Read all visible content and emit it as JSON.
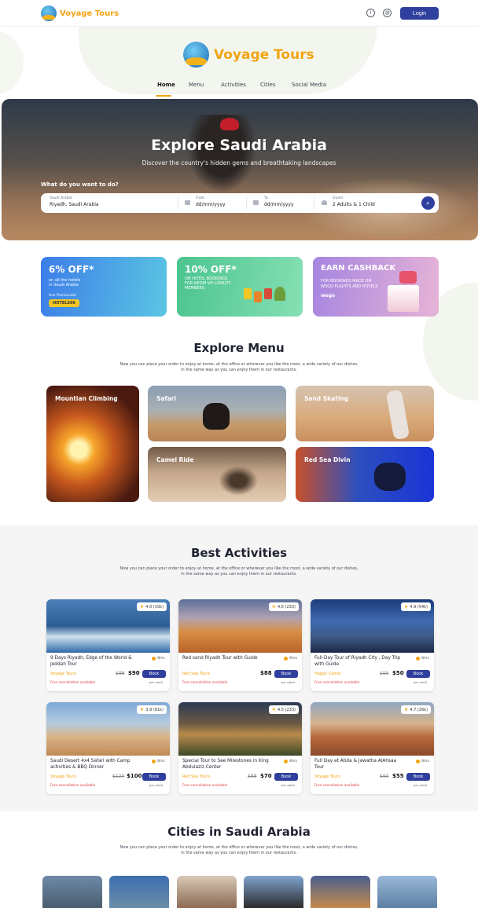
{
  "header": {
    "brand": "Voyage Tours",
    "info_icon": "info-icon",
    "globe_icon": "globe-icon",
    "login_label": "Login"
  },
  "brand_big": "Voyage Tours",
  "nav": {
    "items": [
      "Home",
      "Menu",
      "Activities",
      "Cities",
      "Social Media"
    ],
    "active": "Home"
  },
  "hero": {
    "title": "Explore Saudi Arabia",
    "subtitle": "Discover the country's hidden gems and breathtaking landscapes",
    "question": "What do you want to do?",
    "search": {
      "location_label": "Saudi Arabia",
      "location_value": "Riyadh, Saudi Arabia",
      "from_label": "From",
      "from_placeholder": "dd/mm/yyyy",
      "to_label": "To",
      "to_placeholder": "dd/mm/yyyy",
      "guest_label": "Guest",
      "guest_value": "2 Adults & 1 Child"
    }
  },
  "promos": [
    {
      "headline": "6% OFF*",
      "text": [
        "on all the hotels",
        "in Saudi Arabia"
      ],
      "code_label": "Use Promocode",
      "code": "HOTELS06"
    },
    {
      "headline": "10% OFF*",
      "text": [
        "ON HOTEL BOOKINGS",
        "FOR NEOM VIP LOYALTY",
        "MEMBERS"
      ]
    },
    {
      "headline": "EARN CASHBACK",
      "text": [
        "FOR BOOKINGS MADE ON",
        "WEGO FLIGHTS AND HOTELS"
      ],
      "brand": "wego"
    }
  ],
  "menu_section": {
    "title": "Explore Menu",
    "subtitle_1": "Now you can place your order to enjoy at home, at the office or wherever you like the most, a wide variety of our dishes,",
    "subtitle_2": "in the same way as you can enjoy them in our restaurants.",
    "cards": [
      "Mountian Climbing",
      "Safari",
      "Sand Skating",
      "Camel Ride",
      "Red Sea Divin"
    ]
  },
  "activities_section": {
    "title": "Best Activities",
    "subtitle_1": "Now you can place your order to enjoy at home, at the office or wherever you like the most, a wide variety of our dishes,",
    "subtitle_2": "in the same way as you can enjoy them in our restaurants.",
    "book_label": "Book",
    "per_adult": "per adult",
    "cancellation": "Free cancellation available",
    "items": [
      {
        "rating": "4.0 (15k)",
        "title": "9 Days Riyadh, Edge of the World & Jeddah Tour",
        "duration": "8hrs",
        "provider": "Voyage Tours",
        "old_price": "$88",
        "price": "$90"
      },
      {
        "rating": "4.5 (233)",
        "title": "Red sand Riyadh Tour with Guide",
        "duration": "8hrs",
        "provider": "Red Sea Tours",
        "old_price": "",
        "price": "$88"
      },
      {
        "rating": "4.9 (54k)",
        "title": "Full-Day Tour of Riyadh City , Day Trip with Guide",
        "duration": "8hrs",
        "provider": "Happy Camel",
        "old_price": "$55",
        "price": "$50"
      },
      {
        "rating": "3.9 (81k)",
        "title": "Saudi Desert 4x4 Safari with Camp activities & BBQ Dinner",
        "duration": "8hrs",
        "provider": "Voyage Tours",
        "old_price": "$120",
        "price": "$100"
      },
      {
        "rating": "4.5 (233)",
        "title": "Special Tour to See Milestones in King Abdulaziz Center",
        "duration": "8hrs",
        "provider": "Red Sea Tours",
        "old_price": "$88",
        "price": "$70"
      },
      {
        "rating": "4.7 (26k)",
        "title": "Full Day at AlUla & Jawatha AlAhsaa Tour",
        "duration": "8hrs",
        "provider": "Voyage Tours",
        "old_price": "$60",
        "price": "$55"
      }
    ]
  },
  "cities_section": {
    "title": "Cities in Saudi Arabia",
    "subtitle_1": "Now you can place your order to enjoy at home, at the office or wherever you like the most, a wide variety of our dishes,",
    "subtitle_2": "in the same way as you can enjoy them in our restaurants."
  }
}
